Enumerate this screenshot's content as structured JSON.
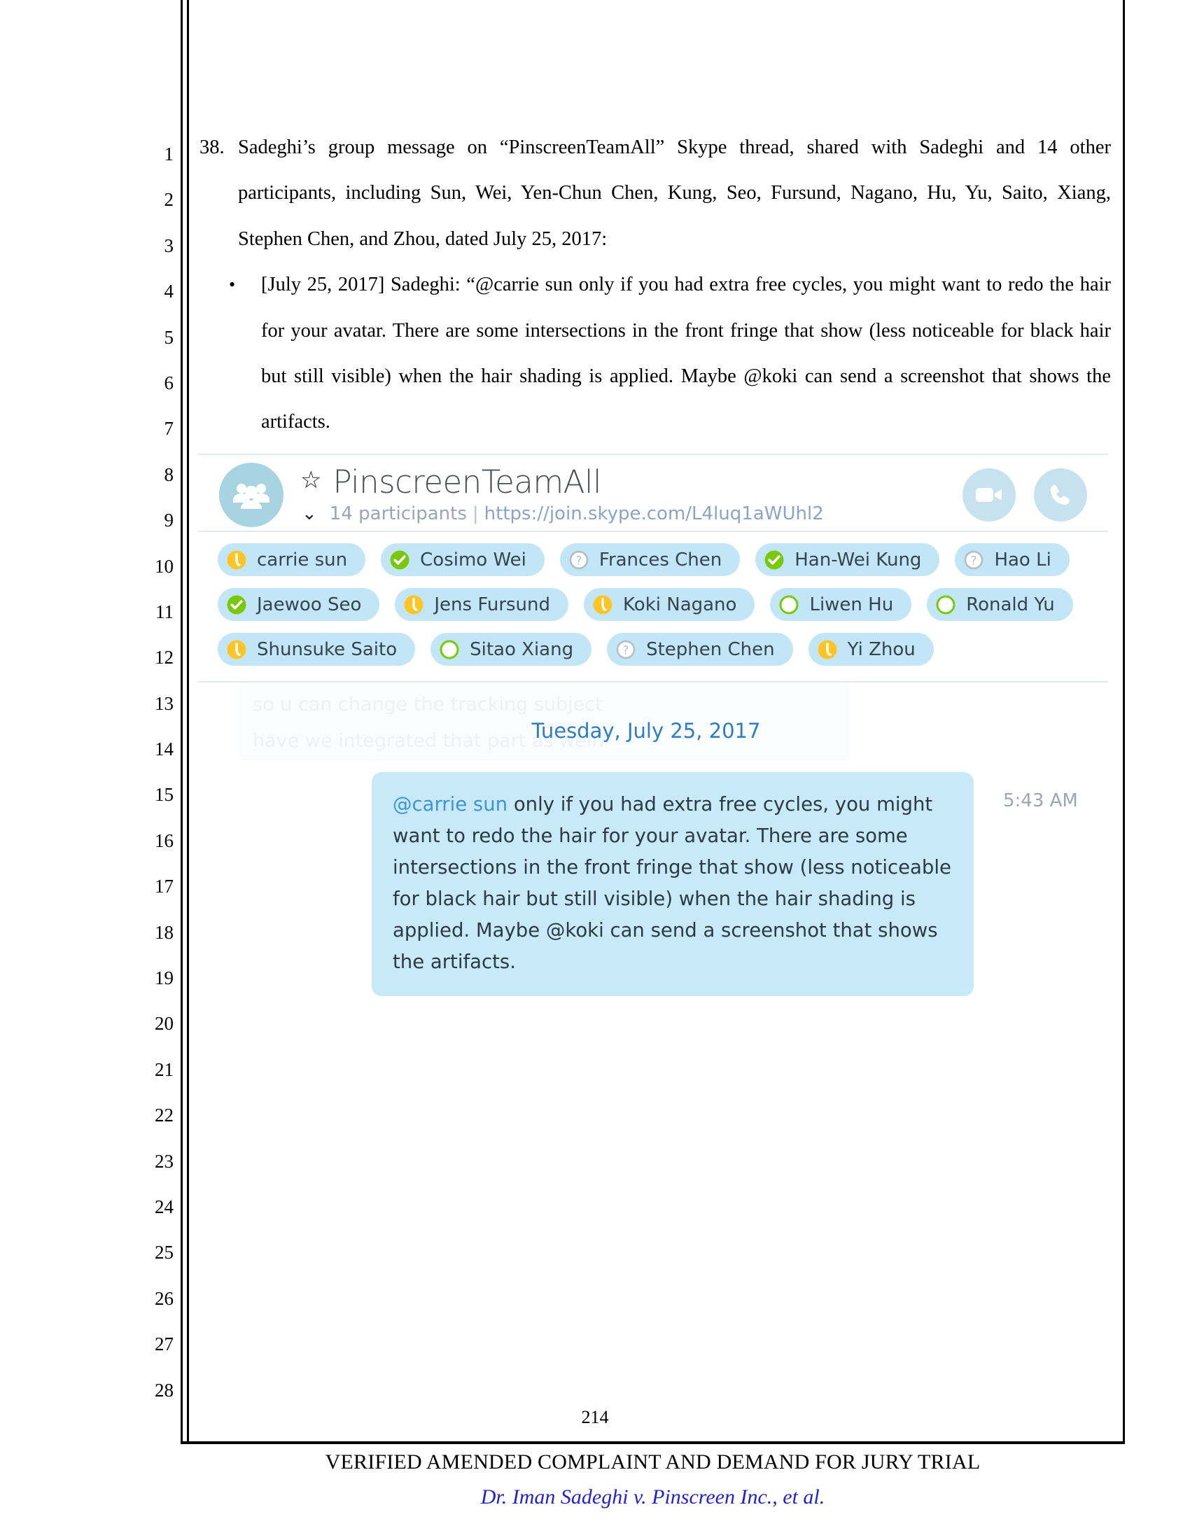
{
  "document": {
    "line_numbers": [
      "1",
      "2",
      "3",
      "4",
      "5",
      "6",
      "7",
      "8",
      "9",
      "10",
      "11",
      "12",
      "13",
      "14",
      "15",
      "16",
      "17",
      "18",
      "19",
      "20",
      "21",
      "22",
      "23",
      "24",
      "25",
      "26",
      "27",
      "28"
    ],
    "paragraph_38": {
      "number": "38.",
      "text": "Sadeghi’s group message on “PinscreenTeamAll” Skype thread, shared with Sadeghi and 14 other participants, including Sun, Wei, Yen-Chun Chen, Kung, Seo, Fursund, Nagano, Hu, Yu, Saito, Xiang, Stephen Chen, and Zhou, dated July 25, 2017:"
    },
    "bullet": {
      "marker": "•",
      "text": "[July 25, 2017] Sadeghi: “@carrie sun only if you had extra free cycles, you might want to redo the hair for your avatar. There are some intersections in the front fringe that show (less noticeable for black hair but still visible) when the hair shading is applied. Maybe @koki can send a screenshot that shows the artifacts."
    },
    "page_number": "214",
    "footer_title": "VERIFIED AMENDED COMPLAINT AND DEMAND FOR JURY TRIAL",
    "footer_case": "Dr. Iman Sadeghi v. Pinscreen Inc., et al."
  },
  "skype": {
    "group_title": "PinscreenTeamAll",
    "favorite_icon": "star-icon",
    "expand_icon": "chevron-down-icon",
    "participants_count_label": "14 participants",
    "separator": "|",
    "join_url": "https://join.skype.com/L4luq1aWUhl2",
    "actions": [
      {
        "name": "video-call-button",
        "icon": "video-camera-icon"
      },
      {
        "name": "audio-call-button",
        "icon": "phone-icon"
      }
    ],
    "participants": [
      [
        {
          "name": "carrie sun",
          "status": "away"
        },
        {
          "name": "Cosimo Wei",
          "status": "online"
        },
        {
          "name": "Frances Chen",
          "status": "unknown"
        },
        {
          "name": "Han-Wei Kung",
          "status": "online"
        },
        {
          "name": "Hao Li",
          "status": "unknown"
        }
      ],
      [
        {
          "name": "Jaewoo Seo",
          "status": "online"
        },
        {
          "name": "Jens Fursund",
          "status": "away"
        },
        {
          "name": "Koki Nagano",
          "status": "away"
        },
        {
          "name": "Liwen Hu",
          "status": "offline"
        },
        {
          "name": "Ronald Yu",
          "status": "offline"
        }
      ],
      [
        {
          "name": "Shunsuke Saito",
          "status": "away"
        },
        {
          "name": "Sitao Xiang",
          "status": "offline"
        },
        {
          "name": "Stephen Chen",
          "status": "unknown"
        },
        {
          "name": "Yi Zhou",
          "status": "away"
        }
      ]
    ],
    "conversation": {
      "ghost_line_1": "so u can change the tracking subject",
      "ghost_line_2": "have we integrated that part as well?",
      "date_divider": "Tuesday, July 25, 2017",
      "message": {
        "mention": "@carrie sun",
        "body": " only if you had extra free cycles, you might want to redo the hair for your avatar. There are some intersections in the front fringe that show (less noticeable for black hair but still visible) when the hair shading is applied. Maybe @koki can send a screenshot that shows the artifacts.",
        "time": "5:43 AM"
      }
    },
    "colors": {
      "chip_background": "#c3e6f7",
      "bubble_background": "#c8e9f8",
      "avatar_background": "#a8d3e0",
      "action_background": "#c7e2ee",
      "status_online": "#7ac70c",
      "status_away": "#ffc425",
      "status_unknown": "#b6bfc7",
      "status_offline": "#7ac70c",
      "date_text": "#2f7dc4",
      "mention_text": "#3d94d6"
    }
  }
}
